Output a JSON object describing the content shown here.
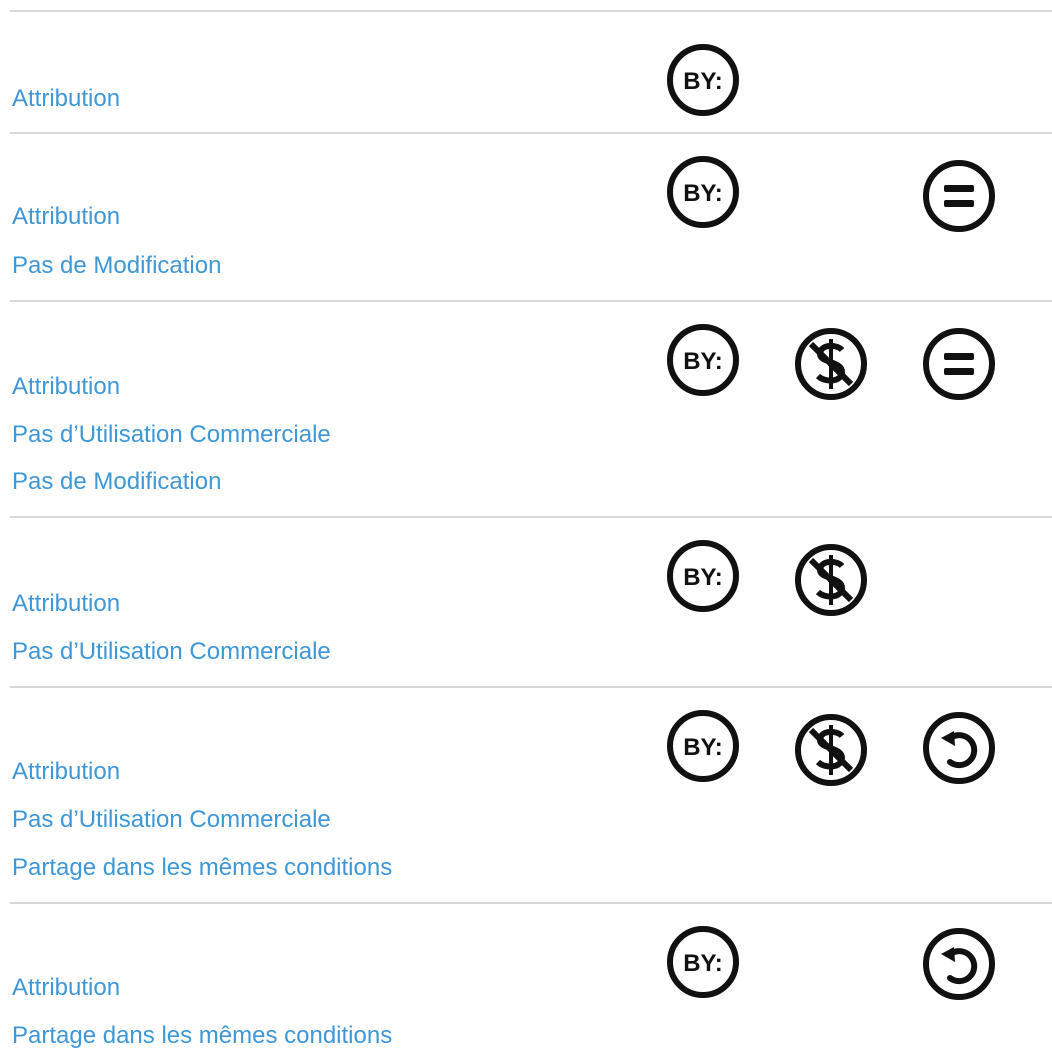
{
  "licenses": [
    {
      "lines": [
        "Attribution"
      ],
      "icons": [
        "by-icon",
        null,
        null
      ]
    },
    {
      "lines": [
        "Attribution",
        "Pas de Modification"
      ],
      "icons": [
        "by-icon",
        null,
        "nd-icon"
      ]
    },
    {
      "lines": [
        "Attribution",
        "Pas d’Utilisation Commerciale",
        "Pas de Modification"
      ],
      "icons": [
        "by-icon",
        "nc-icon",
        "nd-icon"
      ]
    },
    {
      "lines": [
        "Attribution",
        "Pas d’Utilisation Commerciale"
      ],
      "icons": [
        "by-icon",
        "nc-icon",
        null
      ]
    },
    {
      "lines": [
        "Attribution",
        "Pas d’Utilisation Commerciale",
        "Partage dans les mêmes conditions"
      ],
      "icons": [
        "by-icon",
        "nc-icon",
        "sa-icon"
      ]
    },
    {
      "lines": [
        "Attribution",
        "Partage dans les mêmes conditions"
      ],
      "icons": [
        "by-icon",
        null,
        "sa-icon"
      ]
    }
  ],
  "icon_text": {
    "by": "BY:"
  },
  "colors": {
    "link": "#3f97d6",
    "divider": "#d7d7d7",
    "icon": "#111111"
  }
}
